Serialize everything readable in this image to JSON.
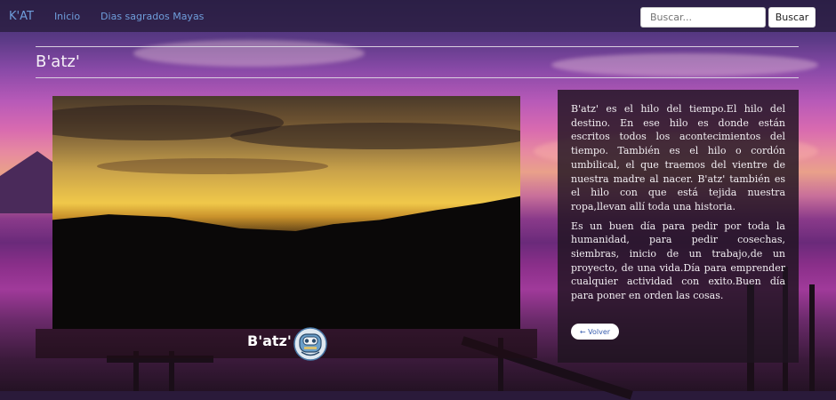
{
  "navbar": {
    "brand": "K'AT",
    "links": [
      "Inicio",
      "Dias sagrados Mayas"
    ],
    "search": {
      "placeholder": "Buscar...",
      "button_label": "Buscar"
    }
  },
  "page": {
    "title": "B'atz'"
  },
  "feature": {
    "caption": "B'atz'",
    "glyph_icon": "batz-glyph-icon"
  },
  "description": {
    "paragraphs": [
      "B'atz' es el hilo del tiempo.El hilo del destino. En ese hilo es donde están escritos todos los acontecimientos del tiempo. También es el hilo o cordón umbilical, el que traemos del vientre de nuestra madre al nacer. B'atz' también es el hilo con que está tejida nuestra ropa,llevan allí toda una historia.",
      "Es un buen día para pedir por toda la humanidad, para pedir cosechas, siembras, inicio de un trabajo,de un proyecto, de una vida.Día para emprender cualquier actividad con exito.Buen día para poner en orden las cosas."
    ],
    "back_button": "← Volver"
  },
  "colors": {
    "nav_link": "#6f9edb",
    "panel_bg": "#1e1420",
    "title_text": "#f4eef6"
  }
}
